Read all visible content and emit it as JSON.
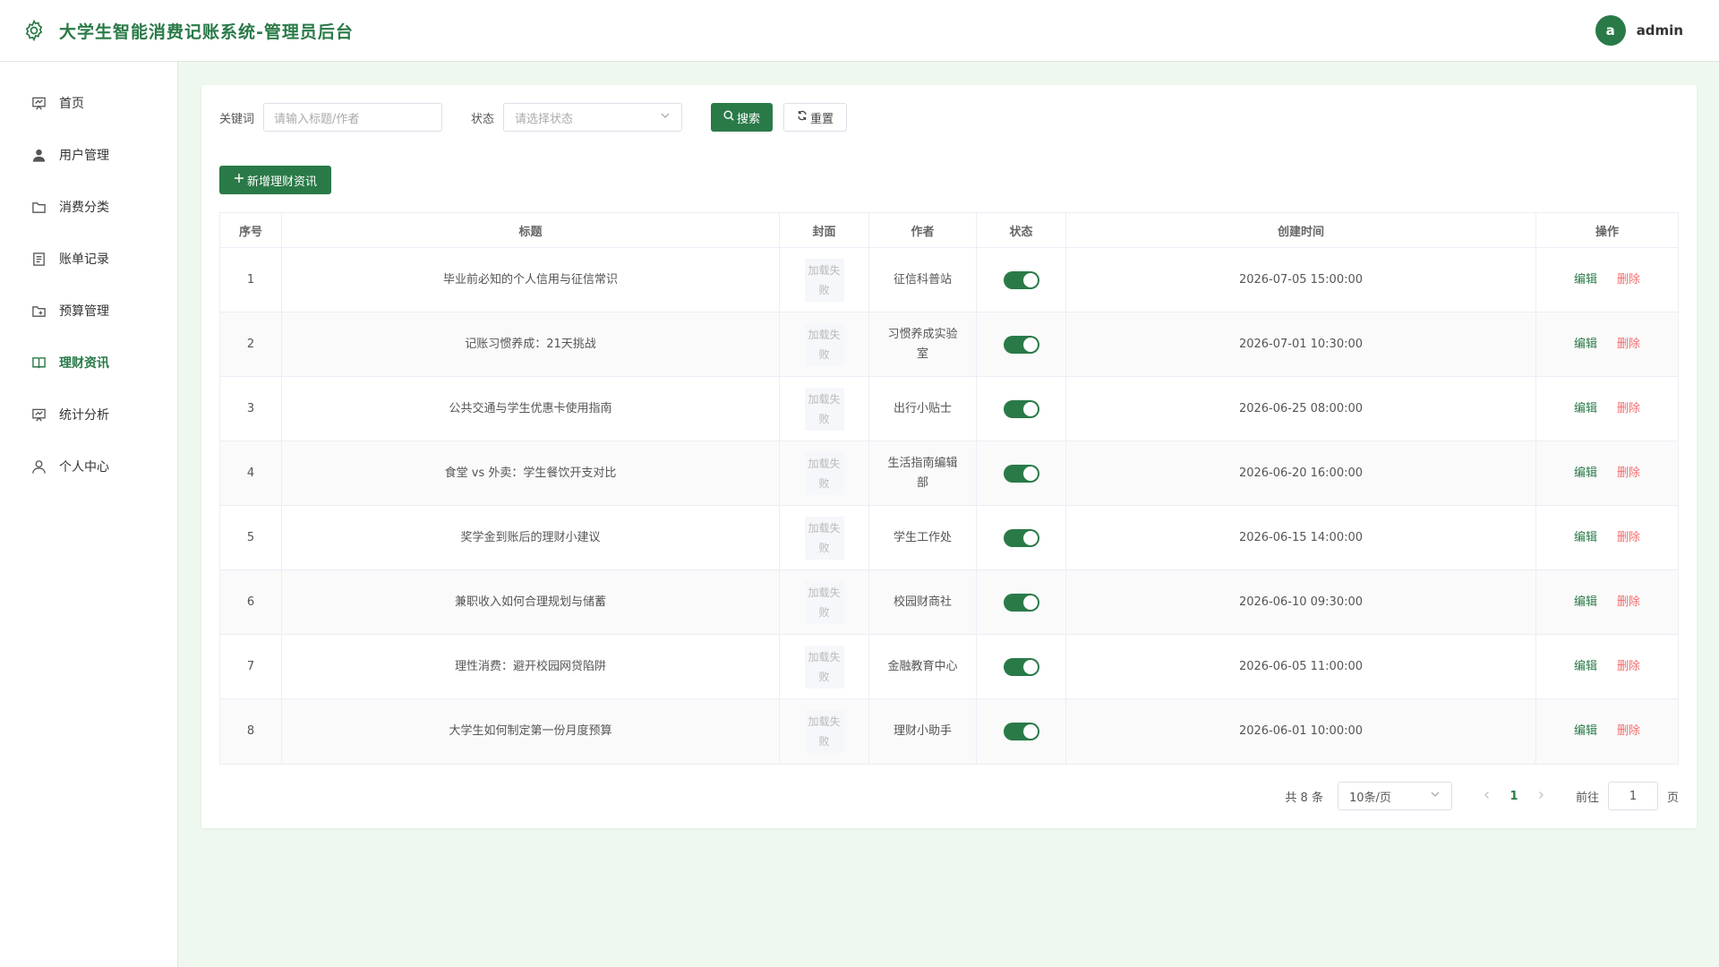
{
  "header": {
    "title": "大学生智能消费记账系统-管理员后台",
    "avatar_letter": "a",
    "username": "admin"
  },
  "sidebar": {
    "items": [
      {
        "label": "首页",
        "icon": "chart-board-icon"
      },
      {
        "label": "用户管理",
        "icon": "user-icon"
      },
      {
        "label": "消费分类",
        "icon": "folder-icon"
      },
      {
        "label": "账单记录",
        "icon": "document-icon"
      },
      {
        "label": "预算管理",
        "icon": "folder-add-icon"
      },
      {
        "label": "理财资讯",
        "icon": "book-icon",
        "active": true
      },
      {
        "label": "统计分析",
        "icon": "chart-board-icon"
      },
      {
        "label": "个人中心",
        "icon": "user-outline-icon"
      }
    ]
  },
  "filters": {
    "keyword_label": "关键词",
    "keyword_placeholder": "请输入标题/作者",
    "status_label": "状态",
    "status_placeholder": "请选择状态",
    "search_label": "搜索",
    "reset_label": "重置"
  },
  "add_button_label": "新增理财资讯",
  "table": {
    "columns": [
      "序号",
      "标题",
      "封面",
      "作者",
      "状态",
      "创建时间",
      "操作"
    ],
    "cover_text": "加载失败",
    "edit_label": "编辑",
    "delete_label": "删除",
    "rows": [
      {
        "index": "1",
        "title": "毕业前必知的个人信用与征信常识",
        "author": "征信科普站",
        "status_on": true,
        "created": "2026-07-05 15:00:00"
      },
      {
        "index": "2",
        "title": "记账习惯养成：21天挑战",
        "author": "习惯养成实验室",
        "status_on": true,
        "created": "2026-07-01 10:30:00"
      },
      {
        "index": "3",
        "title": "公共交通与学生优惠卡使用指南",
        "author": "出行小贴士",
        "status_on": true,
        "created": "2026-06-25 08:00:00"
      },
      {
        "index": "4",
        "title": "食堂 vs 外卖：学生餐饮开支对比",
        "author": "生活指南编辑部",
        "status_on": true,
        "created": "2026-06-20 16:00:00"
      },
      {
        "index": "5",
        "title": "奖学金到账后的理财小建议",
        "author": "学生工作处",
        "status_on": true,
        "created": "2026-06-15 14:00:00"
      },
      {
        "index": "6",
        "title": "兼职收入如何合理规划与储蓄",
        "author": "校园财商社",
        "status_on": true,
        "created": "2026-06-10 09:30:00"
      },
      {
        "index": "7",
        "title": "理性消费：避开校园网贷陷阱",
        "author": "金融教育中心",
        "status_on": true,
        "created": "2026-06-05 11:00:00"
      },
      {
        "index": "8",
        "title": "大学生如何制定第一份月度预算",
        "author": "理财小助手",
        "status_on": true,
        "created": "2026-06-01 10:00:00"
      }
    ]
  },
  "pagination": {
    "total_text": "共 8 条",
    "page_size": "10条/页",
    "current_page": "1",
    "goto_label": "前往",
    "goto_value": "1",
    "page_suffix": "页"
  },
  "colors": {
    "primary": "#2a7a48",
    "danger": "#f56c6c",
    "background": "#eef8ee"
  }
}
